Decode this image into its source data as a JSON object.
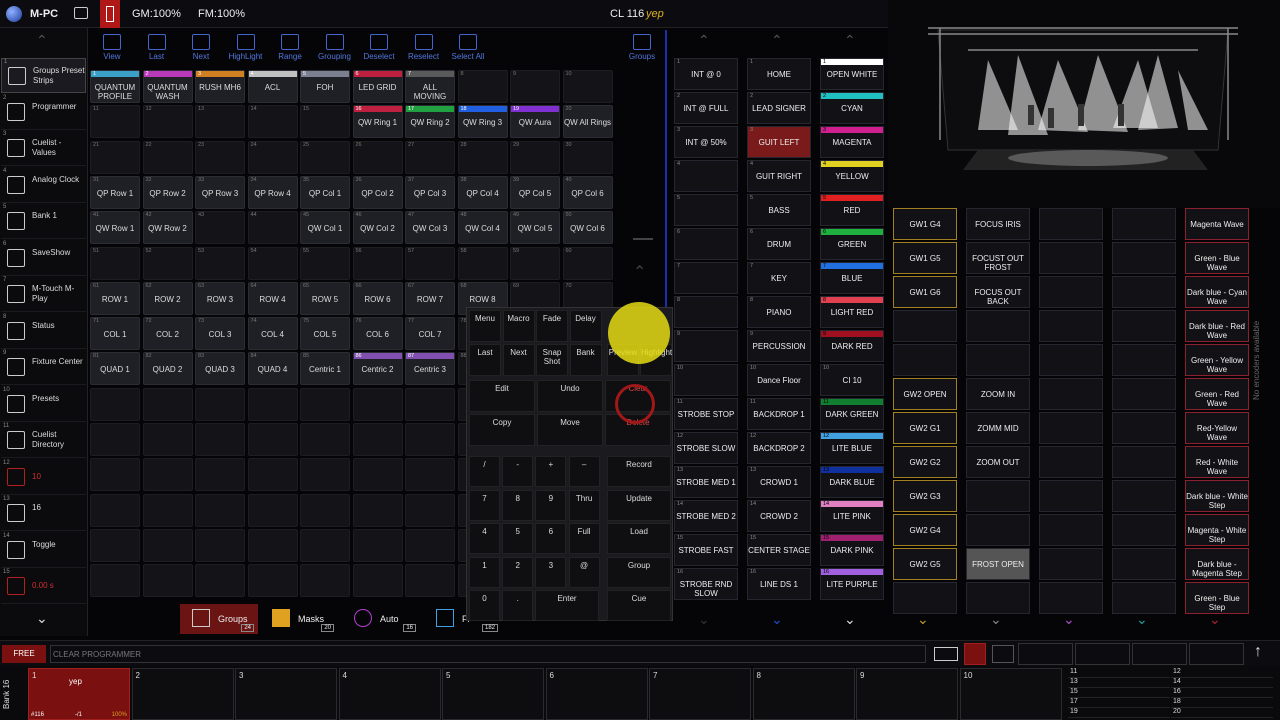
{
  "topbar": {
    "app": "M-PC",
    "gm": "GM:100%",
    "fm": "FM:100%",
    "cue": "CL 116",
    "cue_name": "yep"
  },
  "sidebar": [
    {
      "num": "1",
      "label": "Groups Preset Strips"
    },
    {
      "num": "2",
      "label": "Programmer"
    },
    {
      "num": "3",
      "label": "Cuelist - Values"
    },
    {
      "num": "4",
      "label": "Analog Clock"
    },
    {
      "num": "5",
      "label": "Bank 1"
    },
    {
      "num": "6",
      "label": "SaveShow"
    },
    {
      "num": "7",
      "label": "M-Touch M-Play"
    },
    {
      "num": "8",
      "label": "Status"
    },
    {
      "num": "9",
      "label": "Fixture Center"
    },
    {
      "num": "10",
      "label": "Presets"
    },
    {
      "num": "11",
      "label": "Cuelist Directory"
    },
    {
      "num": "12",
      "label": "10"
    },
    {
      "num": "13",
      "label": "16"
    },
    {
      "num": "14",
      "label": "Toggle"
    },
    {
      "num": "15",
      "label": "0.00 s"
    }
  ],
  "toolbar": [
    "View",
    "Last",
    "Next",
    "HighLight",
    "Range",
    "Grouping",
    "Deselect",
    "Reselect",
    "Select All",
    "Groups"
  ],
  "grid": [
    {
      "n": "1",
      "t": "QUANTUM PROFILE",
      "c": "#3aa0c8"
    },
    {
      "n": "2",
      "t": "QUANTUM WASH",
      "c": "#b83ab8"
    },
    {
      "n": "3",
      "t": "RUSH MH6",
      "c": "#d08020"
    },
    {
      "n": "4",
      "t": "ACL",
      "c": "#c0c0c0"
    },
    {
      "n": "5",
      "t": "FOH",
      "c": "#7a8090"
    },
    {
      "n": "6",
      "t": "LED GRID",
      "c": "#c02040"
    },
    {
      "n": "7",
      "t": "ALL MOVING",
      "c": "#5a5a5a"
    },
    {
      "n": "8",
      "t": ""
    },
    {
      "n": "9",
      "t": ""
    },
    {
      "n": "10",
      "t": ""
    },
    {
      "n": "11",
      "t": ""
    },
    {
      "n": "12",
      "t": ""
    },
    {
      "n": "13",
      "t": ""
    },
    {
      "n": "14",
      "t": ""
    },
    {
      "n": "15",
      "t": ""
    },
    {
      "n": "16",
      "t": "QW Ring 1",
      "c": "#c02040"
    },
    {
      "n": "17",
      "t": "QW Ring 2",
      "c": "#20a040"
    },
    {
      "n": "18",
      "t": "QW Ring 3",
      "c": "#2060e0"
    },
    {
      "n": "19",
      "t": "QW Aura",
      "c": "#8030d0"
    },
    {
      "n": "20",
      "t": "QW All Rings"
    },
    {
      "n": "21",
      "t": ""
    },
    {
      "n": "22",
      "t": ""
    },
    {
      "n": "23",
      "t": ""
    },
    {
      "n": "24",
      "t": ""
    },
    {
      "n": "25",
      "t": ""
    },
    {
      "n": "26",
      "t": ""
    },
    {
      "n": "27",
      "t": ""
    },
    {
      "n": "28",
      "t": ""
    },
    {
      "n": "29",
      "t": ""
    },
    {
      "n": "30",
      "t": ""
    },
    {
      "n": "31",
      "t": "QP Row 1"
    },
    {
      "n": "32",
      "t": "QP Row 2"
    },
    {
      "n": "33",
      "t": "QP Row 3"
    },
    {
      "n": "34",
      "t": "QP Row 4"
    },
    {
      "n": "35",
      "t": "QP Col 1"
    },
    {
      "n": "36",
      "t": "QP Col 2"
    },
    {
      "n": "37",
      "t": "QP Col 3"
    },
    {
      "n": "38",
      "t": "QP Col 4"
    },
    {
      "n": "39",
      "t": "QP Col 5"
    },
    {
      "n": "40",
      "t": "QP Col 6"
    },
    {
      "n": "41",
      "t": "QW Row 1"
    },
    {
      "n": "42",
      "t": "QW Row 2"
    },
    {
      "n": "43",
      "t": ""
    },
    {
      "n": "44",
      "t": ""
    },
    {
      "n": "45",
      "t": "QW Col 1"
    },
    {
      "n": "46",
      "t": "QW Col 2"
    },
    {
      "n": "47",
      "t": "QW Col 3"
    },
    {
      "n": "48",
      "t": "QW Col 4"
    },
    {
      "n": "49",
      "t": "QW Col 5"
    },
    {
      "n": "50",
      "t": "QW Col 6"
    },
    {
      "n": "51",
      "t": ""
    },
    {
      "n": "52",
      "t": ""
    },
    {
      "n": "53",
      "t": ""
    },
    {
      "n": "54",
      "t": ""
    },
    {
      "n": "55",
      "t": ""
    },
    {
      "n": "56",
      "t": ""
    },
    {
      "n": "57",
      "t": ""
    },
    {
      "n": "58",
      "t": ""
    },
    {
      "n": "59",
      "t": ""
    },
    {
      "n": "60",
      "t": ""
    },
    {
      "n": "61",
      "t": "ROW 1"
    },
    {
      "n": "62",
      "t": "ROW 2"
    },
    {
      "n": "63",
      "t": "ROW 3"
    },
    {
      "n": "64",
      "t": "ROW 4"
    },
    {
      "n": "65",
      "t": "ROW 5"
    },
    {
      "n": "66",
      "t": "ROW 6"
    },
    {
      "n": "67",
      "t": "ROW 7"
    },
    {
      "n": "68",
      "t": "ROW 8"
    },
    {
      "n": "69",
      "t": ""
    },
    {
      "n": "70",
      "t": ""
    },
    {
      "n": "71",
      "t": "COL 1"
    },
    {
      "n": "72",
      "t": "COL 2"
    },
    {
      "n": "73",
      "t": "COL 3"
    },
    {
      "n": "74",
      "t": "COL 4"
    },
    {
      "n": "75",
      "t": "COL 5"
    },
    {
      "n": "76",
      "t": "COL 6"
    },
    {
      "n": "77",
      "t": "COL 7"
    },
    {
      "n": "78",
      "t": ""
    },
    {
      "n": "79",
      "t": ""
    },
    {
      "n": "80",
      "t": ""
    },
    {
      "n": "81",
      "t": "QUAD 1"
    },
    {
      "n": "82",
      "t": "QUAD 2"
    },
    {
      "n": "83",
      "t": "QUAD 3"
    },
    {
      "n": "84",
      "t": "QUAD 4"
    },
    {
      "n": "85",
      "t": "Centric 1"
    },
    {
      "n": "86",
      "t": "Centric 2",
      "c": "#8050b0"
    },
    {
      "n": "87",
      "t": "Centric 3",
      "c": "#8050b0"
    },
    {
      "n": "88",
      "t": ""
    },
    {
      "n": "89",
      "t": ""
    },
    {
      "n": "90",
      "t": ""
    }
  ],
  "bottomtabs": [
    {
      "label": "Groups",
      "count": "24"
    },
    {
      "label": "Masks",
      "count": "20"
    },
    {
      "label": "Auto",
      "count": "16"
    },
    {
      "label": "Fi",
      "count": "182"
    }
  ],
  "keypad": {
    "row1": [
      "Menu",
      "Macro",
      "Fade",
      "Delay"
    ],
    "row2": [
      "Last",
      "Next",
      "Snap Shot",
      "Bank",
      "Preview",
      "Highlight"
    ],
    "edit": [
      "Edit",
      "Undo",
      "Clear"
    ],
    "copy": [
      "Copy",
      "Move",
      "Delete"
    ],
    "nums": [
      "/",
      "-",
      "+",
      "–",
      "7",
      "8",
      "9",
      "Thru",
      "4",
      "5",
      "6",
      "Full",
      "1",
      "2",
      "3",
      "@",
      "0",
      ".",
      "Enter"
    ],
    "right": [
      "Record",
      "Update",
      "Load",
      "Group",
      "Cue"
    ]
  },
  "playback": [
    [
      {
        "n": "1",
        "t": "INT @ 0"
      },
      {
        "n": "2",
        "t": "INT @ FULL"
      },
      {
        "n": "3",
        "t": "INT @ 50%"
      },
      {
        "n": "4",
        "t": ""
      },
      {
        "n": "5",
        "t": ""
      },
      {
        "n": "6",
        "t": ""
      },
      {
        "n": "7",
        "t": ""
      },
      {
        "n": "8",
        "t": ""
      },
      {
        "n": "9",
        "t": ""
      },
      {
        "n": "10",
        "t": ""
      },
      {
        "n": "11",
        "t": "STROBE STOP"
      },
      {
        "n": "12",
        "t": "STROBE SLOW"
      },
      {
        "n": "13",
        "t": "STROBE MED 1"
      },
      {
        "n": "14",
        "t": "STROBE MED 2"
      },
      {
        "n": "15",
        "t": "STROBE FAST"
      },
      {
        "n": "16",
        "t": "STROBE RND SLOW"
      }
    ],
    [
      {
        "n": "1",
        "t": "HOME"
      },
      {
        "n": "2",
        "t": "LEAD SIGNER"
      },
      {
        "n": "3",
        "t": "GUIT LEFT",
        "hl": true
      },
      {
        "n": "4",
        "t": "GUIT RIGHT"
      },
      {
        "n": "5",
        "t": "BASS"
      },
      {
        "n": "6",
        "t": "DRUM"
      },
      {
        "n": "7",
        "t": "KEY"
      },
      {
        "n": "8",
        "t": "PIANO"
      },
      {
        "n": "9",
        "t": "PERCUSSION"
      },
      {
        "n": "10",
        "t": "Dance Floor"
      },
      {
        "n": "11",
        "t": "BACKDROP 1"
      },
      {
        "n": "12",
        "t": "BACKDROP 2"
      },
      {
        "n": "13",
        "t": "CROWD 1"
      },
      {
        "n": "14",
        "t": "CROWD 2"
      },
      {
        "n": "15",
        "t": "CENTER STAGE"
      },
      {
        "n": "16",
        "t": "LINE DS 1"
      }
    ],
    [
      {
        "n": "1",
        "t": "OPEN WHITE",
        "c": "#ffffff"
      },
      {
        "n": "2",
        "t": "CYAN",
        "c": "#20c0c0"
      },
      {
        "n": "3",
        "t": "MAGENTA",
        "c": "#d02090"
      },
      {
        "n": "4",
        "t": "YELLOW",
        "c": "#e0d020"
      },
      {
        "n": "5",
        "t": "RED",
        "c": "#e02020"
      },
      {
        "n": "6",
        "t": "GREEN",
        "c": "#20b040"
      },
      {
        "n": "7",
        "t": "BLUE",
        "c": "#2070e0"
      },
      {
        "n": "8",
        "t": "LIGHT RED",
        "c": "#e04050"
      },
      {
        "n": "9",
        "t": "DARK RED",
        "c": "#a01020"
      },
      {
        "n": "10",
        "t": "CI 10"
      },
      {
        "n": "11",
        "t": "DARK GREEN",
        "c": "#108030"
      },
      {
        "n": "12",
        "t": "LITE BLUE",
        "c": "#40a0e0"
      },
      {
        "n": "13",
        "t": "DARK BLUE",
        "c": "#1030a0"
      },
      {
        "n": "14",
        "t": "LITE PINK",
        "c": "#e080c0"
      },
      {
        "n": "15",
        "t": "DARK PINK",
        "c": "#a02070"
      },
      {
        "n": "16",
        "t": "LITE PURPLE",
        "c": "#a060e0"
      }
    ],
    [
      {
        "n": "",
        "t": "GW1 G4"
      },
      {
        "n": "",
        "t": "GW1 G5"
      },
      {
        "n": "",
        "t": "GW1 G6"
      },
      {
        "n": "",
        "t": ""
      },
      {
        "n": "",
        "t": ""
      },
      {
        "n": "",
        "t": "GW2 OPEN"
      },
      {
        "n": "",
        "t": "GW2 G1"
      },
      {
        "n": "",
        "t": "GW2 G2"
      },
      {
        "n": "",
        "t": "GW2 G3"
      },
      {
        "n": "",
        "t": "GW2 G4"
      },
      {
        "n": "",
        "t": "GW2 G5"
      }
    ],
    [
      {
        "n": "",
        "t": "FOCUS IRIS"
      },
      {
        "n": "",
        "t": "FOCUST OUT FROST"
      },
      {
        "n": "",
        "t": "FOCUS OUT BACK"
      },
      {
        "n": "",
        "t": ""
      },
      {
        "n": "",
        "t": ""
      },
      {
        "n": "",
        "t": "ZOOM IN"
      },
      {
        "n": "",
        "t": "ZOMM MID"
      },
      {
        "n": "",
        "t": "ZOOM OUT"
      },
      {
        "n": "",
        "t": ""
      },
      {
        "n": "",
        "t": ""
      },
      {
        "n": "",
        "t": "FROST OPEN"
      }
    ],
    [],
    [],
    [
      {
        "n": "",
        "t": "Magenta Wave"
      },
      {
        "n": "",
        "t": "Green - Blue Wave"
      },
      {
        "n": "",
        "t": "Dark blue - Cyan Wave"
      },
      {
        "n": "",
        "t": "Dark blue - Red Wave"
      },
      {
        "n": "",
        "t": "Green - Yellow Wave"
      },
      {
        "n": "",
        "t": "Green - Red Wave"
      },
      {
        "n": "",
        "t": "Red-Yellow Wave"
      },
      {
        "n": "",
        "t": "Red - White Wave"
      },
      {
        "n": "",
        "t": "Dark blue - White Step"
      },
      {
        "n": "",
        "t": "Magenta - White Step"
      },
      {
        "n": "",
        "t": "Dark blue - Magenta Step"
      },
      {
        "n": "",
        "t": "Green - Blue Step"
      }
    ]
  ],
  "side_note": "No encoders available",
  "cmdline": {
    "free": "FREE",
    "text": "CLEAR PROGRAMMER"
  },
  "bank": "Bank 16",
  "executors": [
    {
      "n": "1",
      "name": "yep",
      "cue": "#116",
      "pos": "-/1",
      "lvl": "100%"
    },
    {
      "n": "2"
    },
    {
      "n": "3"
    },
    {
      "n": "4"
    },
    {
      "n": "5"
    },
    {
      "n": "6"
    },
    {
      "n": "7"
    },
    {
      "n": "8"
    },
    {
      "n": "9"
    },
    {
      "n": "10"
    }
  ],
  "small_exec": [
    "11",
    "12",
    "13",
    "14",
    "15",
    "16",
    "17",
    "18",
    "19",
    "20"
  ]
}
